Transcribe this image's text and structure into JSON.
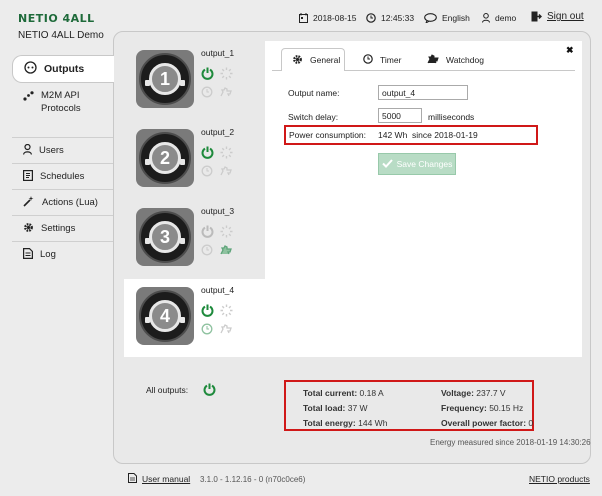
{
  "header": {
    "logo": "NETIO 4ALL",
    "device_name": "NETIO 4ALL Demo",
    "date": "2018-08-15",
    "time": "12:45:33",
    "language": "English",
    "user": "demo",
    "sign_out": "Sign out"
  },
  "sidebar": {
    "items": [
      {
        "label": "Outputs",
        "icon": "outputs-icon",
        "active": true
      },
      {
        "label": "M2M API",
        "label2": "Protocols",
        "icon": "m2m-icon"
      },
      {
        "label": "Users",
        "icon": "user-icon"
      },
      {
        "label": "Schedules",
        "icon": "schedule-icon"
      },
      {
        "label": "Actions (Lua)",
        "icon": "wand-icon"
      },
      {
        "label": "Settings",
        "icon": "gear-icon"
      },
      {
        "label": "Log",
        "icon": "log-icon"
      }
    ]
  },
  "outputs": [
    {
      "number": "1",
      "name": "output_1",
      "power_on": true
    },
    {
      "number": "2",
      "name": "output_2",
      "power_on": true
    },
    {
      "number": "3",
      "name": "output_3",
      "power_on": false
    },
    {
      "number": "4",
      "name": "output_4",
      "power_on": true
    }
  ],
  "panel": {
    "tabs": [
      "General",
      "Timer",
      "Watchdog"
    ],
    "close": "✖",
    "output_name_label": "Output name:",
    "output_name_value": "output_4",
    "switch_delay_label": "Switch delay:",
    "switch_delay_value": "5000",
    "switch_delay_unit": "milliseconds",
    "power_consumption_label": "Power consumption:",
    "power_consumption_value": "142 Wh  since 2018-01-19",
    "save_label": "Save Changes"
  },
  "all_outputs": {
    "label": "All outputs:"
  },
  "stats": {
    "total_current_label": "Total current:",
    "total_current": "0.18 A",
    "total_load_label": "Total load:",
    "total_load": "37 W",
    "total_energy_label": "Total energy:",
    "total_energy": "144 Wh",
    "voltage_label": "Voltage:",
    "voltage": "237.7 V",
    "frequency_label": "Frequency:",
    "frequency": "50.15 Hz",
    "power_factor_label": "Overall power factor:",
    "power_factor": "0",
    "measured_since": "Energy measured since 2018-01-19 14:30:26"
  },
  "footer": {
    "manual": "User manual",
    "version": "3.1.0 - 1.12.16 - 0 (n70c0ce6)",
    "products": "NETIO products"
  },
  "colors": {
    "accent": "#1e8a3c",
    "highlight": "#d01818",
    "disabled": "#b8dcc5"
  }
}
